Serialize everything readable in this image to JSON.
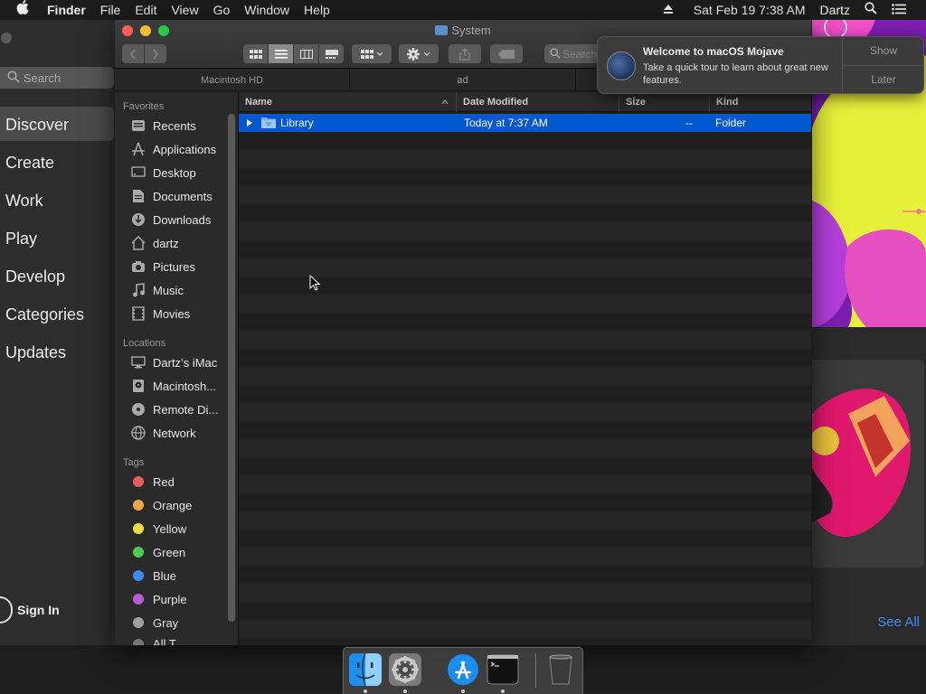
{
  "menubar": {
    "app": "Finder",
    "menus": [
      "File",
      "Edit",
      "View",
      "Go",
      "Window",
      "Help"
    ],
    "datetime": "Sat Feb 19  7:38 AM",
    "user": "Dartz"
  },
  "appstore": {
    "search_placeholder": "Search",
    "nav": [
      "Discover",
      "Create",
      "Work",
      "Play",
      "Develop",
      "Categories",
      "Updates"
    ],
    "sign_in": "Sign In",
    "see_all": "See All"
  },
  "finder": {
    "title": "System",
    "search_placeholder": "Search",
    "path_tabs": [
      "Macintosh HD",
      "ad"
    ],
    "sidebar": {
      "favorites_header": "Favorites",
      "favorites": [
        {
          "label": "Recents",
          "icon": "recents-icon"
        },
        {
          "label": "Applications",
          "icon": "applications-icon"
        },
        {
          "label": "Desktop",
          "icon": "desktop-icon"
        },
        {
          "label": "Documents",
          "icon": "documents-icon"
        },
        {
          "label": "Downloads",
          "icon": "downloads-icon"
        },
        {
          "label": "dartz",
          "icon": "home-icon"
        },
        {
          "label": "Pictures",
          "icon": "camera-icon"
        },
        {
          "label": "Music",
          "icon": "music-icon"
        },
        {
          "label": "Movies",
          "icon": "film-icon"
        }
      ],
      "locations_header": "Locations",
      "locations": [
        {
          "label": "Dartz’s iMac",
          "icon": "computer-icon"
        },
        {
          "label": "Macintosh...",
          "icon": "disk-icon"
        },
        {
          "label": "Remote Di...",
          "icon": "optical-disc-icon"
        },
        {
          "label": "Network",
          "icon": "globe-icon"
        }
      ],
      "tags_header": "Tags",
      "tags": [
        {
          "label": "Red",
          "color": "#ed5c5c"
        },
        {
          "label": "Orange",
          "color": "#f4a544"
        },
        {
          "label": "Yellow",
          "color": "#f5dc40"
        },
        {
          "label": "Green",
          "color": "#4fcb55"
        },
        {
          "label": "Blue",
          "color": "#3a8bea"
        },
        {
          "label": "Purple",
          "color": "#b65dd4"
        },
        {
          "label": "Gray",
          "color": "#a0a0a0"
        },
        {
          "label": "All T...",
          "color": ""
        }
      ]
    },
    "columns": {
      "name": "Name",
      "date": "Date Modified",
      "size": "Size",
      "kind": "Kind"
    },
    "rows": [
      {
        "name": "Library",
        "date": "Today at 7:37 AM",
        "size": "--",
        "kind": "Folder"
      }
    ]
  },
  "notification": {
    "title": "Welcome to macOS Mojave",
    "body": "Take a quick tour to learn about great new features.",
    "show": "Show",
    "later": "Later"
  },
  "dock": {
    "apps": [
      "finder-icon",
      "system-preferences-icon",
      "app-store-icon",
      "terminal-icon",
      "trash-icon"
    ]
  }
}
